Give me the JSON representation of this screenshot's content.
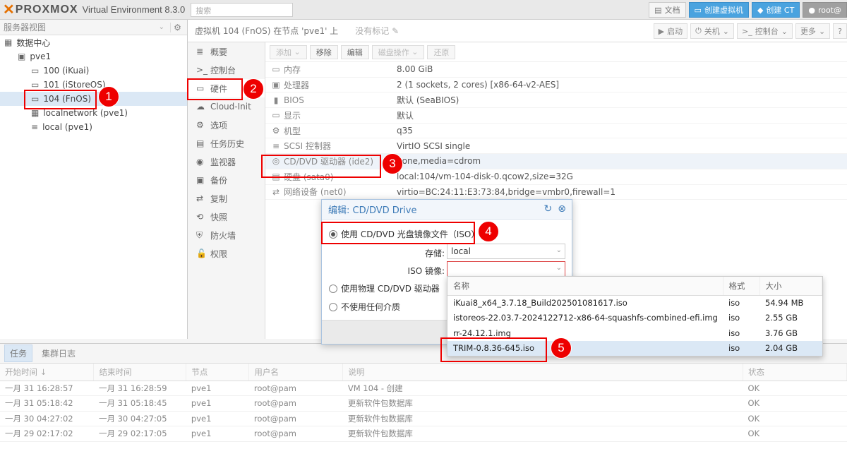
{
  "top": {
    "brand": "PROXMOX",
    "product": "Virtual Environment 8.3.0",
    "search_placeholder": "搜索",
    "docs": "文档",
    "create_vm": "创建虚拟机",
    "create_ct": "创建 CT",
    "user": "root@"
  },
  "left": {
    "view_select": "服务器视图",
    "tree": [
      {
        "label": "数据中心",
        "level": 0,
        "icon": "datacenter-icon"
      },
      {
        "label": "pve1",
        "level": 1,
        "icon": "node-icon"
      },
      {
        "label": "100 (iKuai)",
        "level": 2,
        "icon": "vm-icon"
      },
      {
        "label": "101 (iStoreOS)",
        "level": 2,
        "icon": "vm-icon"
      },
      {
        "label": "104 (FnOS)",
        "level": 2,
        "icon": "vm-icon"
      },
      {
        "label": "localnetwork (pve1)",
        "level": 2,
        "icon": "network-icon"
      },
      {
        "label": "local (pve1)",
        "level": 2,
        "icon": "storage-icon"
      }
    ]
  },
  "header": {
    "title": "虚拟机 104 (FnOS) 在节点 'pve1' 上",
    "no_tags": "没有标记",
    "start": "启动",
    "shutdown": "关机",
    "console": "控制台",
    "more": "更多",
    "help": "?"
  },
  "nav": {
    "items": [
      "概要",
      "控制台",
      "硬件",
      "Cloud-Init",
      "选项",
      "任务历史",
      "监视器",
      "备份",
      "复制",
      "快照",
      "防火墙",
      "权限"
    ]
  },
  "toolbar": {
    "add": "添加",
    "remove": "移除",
    "edit": "编辑",
    "disk_ops": "磁盘操作",
    "revert": "还原"
  },
  "hardware": [
    {
      "name": "内存",
      "value": "8.00 GiB",
      "icon": "memory-icon"
    },
    {
      "name": "处理器",
      "value": "2 (1 sockets, 2 cores) [x86-64-v2-AES]",
      "icon": "cpu-icon"
    },
    {
      "name": "BIOS",
      "value": "默认 (SeaBIOS)",
      "icon": "bios-icon"
    },
    {
      "name": "显示",
      "value": "默认",
      "icon": "monitor-icon"
    },
    {
      "name": "机型",
      "value": "q35",
      "icon": "machine-icon"
    },
    {
      "name": "SCSI 控制器",
      "value": "VirtIO SCSI single",
      "icon": "scsi-icon"
    },
    {
      "name": "CD/DVD 驱动器 (ide2)",
      "value": "none,media=cdrom",
      "icon": "cdrom-icon"
    },
    {
      "name": "硬盘 (sata0)",
      "value": "local:104/vm-104-disk-0.qcow2,size=32G",
      "icon": "disk-icon"
    },
    {
      "name": "网络设备 (net0)",
      "value": "virtio=BC:24:11:E3:73:84,bridge=vmbr0,firewall=1",
      "icon": "network-icon"
    }
  ],
  "modal": {
    "title": "编辑: CD/DVD Drive",
    "opt_iso": "使用 CD/DVD 光盘镜像文件（ISO）",
    "storage_label": "存储:",
    "storage_value": "local",
    "iso_label": "ISO 镜像:",
    "opt_physical": "使用物理 CD/DVD 驱动器",
    "opt_none": "不使用任何介质"
  },
  "iso_list": {
    "headers": [
      "名称",
      "格式",
      "大小"
    ],
    "rows": [
      {
        "name": "iKuai8_x64_3.7.18_Build202501081617.iso",
        "format": "iso",
        "size": "54.94 MB"
      },
      {
        "name": "istoreos-22.03.7-2024122712-x86-64-squashfs-combined-efi.img",
        "format": "iso",
        "size": "2.55 GB"
      },
      {
        "name": "rr-24.12.1.img",
        "format": "iso",
        "size": "3.76 GB"
      },
      {
        "name": "TRIM-0.8.36-645.iso",
        "format": "iso",
        "size": "2.04 GB"
      }
    ]
  },
  "bottom": {
    "tab_tasks": "任务",
    "tab_log": "集群日志",
    "headers": [
      "开始时间 ↓",
      "结束时间",
      "节点",
      "用户名",
      "说明",
      "状态"
    ],
    "rows": [
      {
        "start": "一月 31 16:28:57",
        "end": "一月 31 16:28:59",
        "node": "pve1",
        "user": "root@pam",
        "desc": "VM 104 - 创建",
        "status": "OK"
      },
      {
        "start": "一月 31 05:18:42",
        "end": "一月 31 05:18:45",
        "node": "pve1",
        "user": "root@pam",
        "desc": "更新软件包数据库",
        "status": "OK"
      },
      {
        "start": "一月 30 04:27:02",
        "end": "一月 30 04:27:05",
        "node": "pve1",
        "user": "root@pam",
        "desc": "更新软件包数据库",
        "status": "OK"
      },
      {
        "start": "一月 29 02:17:02",
        "end": "一月 29 02:17:05",
        "node": "pve1",
        "user": "root@pam",
        "desc": "更新软件包数据库",
        "status": "OK"
      }
    ]
  },
  "annotations": [
    "1",
    "2",
    "3",
    "4",
    "5"
  ]
}
